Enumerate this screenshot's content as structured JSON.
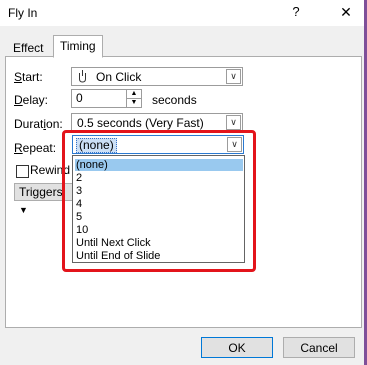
{
  "window": {
    "title": "Fly In",
    "help_label": "?",
    "close_label": "✕"
  },
  "tabs": [
    {
      "label": "Effect"
    },
    {
      "label": "Timing"
    }
  ],
  "fields": {
    "start": {
      "label_key": "S",
      "label_rest": "tart:",
      "value": "On Click"
    },
    "delay": {
      "label_key": "D",
      "label_rest": "elay:",
      "value": "0",
      "unit": "seconds"
    },
    "duration": {
      "label_pre": "Durat",
      "label_key": "i",
      "label_rest": "on:",
      "value": "0.5 seconds (Very Fast)"
    },
    "repeat": {
      "label_key": "R",
      "label_rest": "epeat:",
      "value": "(none)"
    },
    "rewind": {
      "label": "Rewind"
    },
    "triggers": {
      "label": "Triggers"
    }
  },
  "repeat_options": [
    "(none)",
    "2",
    "3",
    "4",
    "5",
    "10",
    "Until Next Click",
    "Until End of Slide"
  ],
  "buttons": {
    "ok": "OK",
    "cancel": "Cancel"
  },
  "colors": {
    "highlight": "#e3141b",
    "selection": "#99c9ef",
    "accent": "#0078d7"
  },
  "icons": {
    "start": "mouse-click-icon",
    "dropdown": "chevron-down-icon"
  }
}
